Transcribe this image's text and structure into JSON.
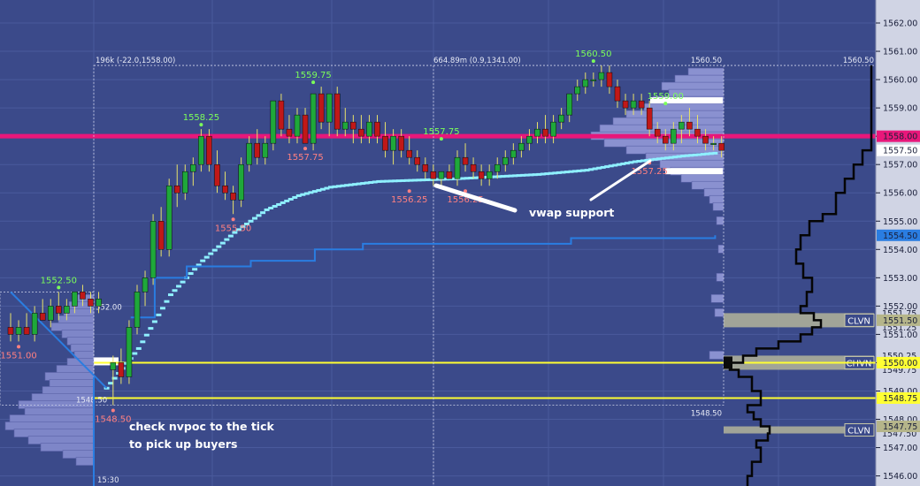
{
  "chart_data": {
    "type": "candlestick",
    "axis": {
      "ylim": [
        1545.8,
        1562.5
      ],
      "ticks": [
        1562.0,
        1561.0,
        1560.0,
        1559.0,
        1558.0,
        1557.0,
        1556.0,
        1555.0,
        1554.0,
        1553.0,
        1552.0,
        1551.0,
        1550.0,
        1549.0,
        1548.0,
        1547.0,
        1546.0
      ],
      "tick_labels": [
        "1562.00",
        "1561.00",
        "1560.00",
        "1559.00",
        "1558.00",
        "1557.00",
        "1556.00",
        "1555.00",
        "1554.00",
        "1553.00",
        "1552.00",
        "1551.00",
        "1550.00",
        "1549.00",
        "1548.00",
        "1547.00",
        "1546.00"
      ],
      "price_tags": [
        {
          "value": 1558.0,
          "text": "1558.00",
          "color": "#e8177a"
        },
        {
          "value": 1557.5,
          "text": "1557.50",
          "color": "#ffffff"
        },
        {
          "value": 1554.5,
          "text": "1554.50",
          "color": "#2a7de1"
        },
        {
          "value": 1551.5,
          "text": "1551.50",
          "color": "#b5b58a"
        },
        {
          "value": 1550.0,
          "text": "1550.00",
          "color": "#ffff33"
        },
        {
          "value": 1548.75,
          "text": "1548.75",
          "color": "#ffff33"
        },
        {
          "value": 1547.75,
          "text": "1547.75",
          "color": "#b5b58a"
        }
      ],
      "minor_texts": [
        {
          "value": 1551.75,
          "text": "1551.75"
        },
        {
          "value": 1551.25,
          "text": "1551.25"
        },
        {
          "value": 1550.25,
          "text": "1550.25"
        },
        {
          "value": 1549.75,
          "text": "1549.75"
        },
        {
          "value": 1547.5,
          "text": "1547.50"
        }
      ]
    },
    "candles": [
      [
        1551.25,
        1551.75,
        1550.75,
        1551.0
      ],
      [
        1551.0,
        1551.5,
        1550.75,
        1551.25
      ],
      [
        1551.25,
        1551.75,
        1551.0,
        1551.0
      ],
      [
        1551.0,
        1552.0,
        1550.75,
        1551.75
      ],
      [
        1551.75,
        1552.25,
        1551.5,
        1551.5
      ],
      [
        1551.5,
        1552.25,
        1551.25,
        1552.0
      ],
      [
        1552.0,
        1552.5,
        1551.5,
        1551.75
      ],
      [
        1551.75,
        1552.25,
        1551.5,
        1552.0
      ],
      [
        1552.0,
        1552.5,
        1551.75,
        1552.5
      ],
      [
        1552.5,
        1552.75,
        1552.0,
        1552.25
      ],
      [
        1552.25,
        1552.5,
        1551.75,
        1552.0
      ],
      [
        1552.0,
        1552.5,
        1551.75,
        1552.25
      ],
      [
        1549.75,
        1550.25,
        1548.5,
        1550.0
      ],
      [
        1550.0,
        1550.5,
        1549.25,
        1549.5
      ],
      [
        1549.5,
        1551.5,
        1549.25,
        1551.25
      ],
      [
        1551.25,
        1552.75,
        1551.0,
        1552.5
      ],
      [
        1552.5,
        1553.25,
        1552.0,
        1553.0
      ],
      [
        1553.0,
        1555.25,
        1552.75,
        1555.0
      ],
      [
        1555.0,
        1555.5,
        1553.75,
        1554.0
      ],
      [
        1554.0,
        1556.5,
        1553.75,
        1556.25
      ],
      [
        1556.25,
        1557.0,
        1555.5,
        1556.0
      ],
      [
        1556.0,
        1557.0,
        1555.75,
        1556.75
      ],
      [
        1556.75,
        1557.25,
        1556.25,
        1557.0
      ],
      [
        1557.0,
        1558.25,
        1556.75,
        1558.0
      ],
      [
        1558.0,
        1558.25,
        1556.75,
        1557.0
      ],
      [
        1557.0,
        1557.5,
        1556.0,
        1556.25
      ],
      [
        1556.25,
        1556.75,
        1555.75,
        1556.0
      ],
      [
        1556.0,
        1556.25,
        1555.25,
        1555.75
      ],
      [
        1555.75,
        1557.25,
        1555.5,
        1557.0
      ],
      [
        1557.0,
        1558.0,
        1556.75,
        1557.75
      ],
      [
        1557.75,
        1558.25,
        1557.0,
        1557.25
      ],
      [
        1557.25,
        1558.0,
        1557.0,
        1557.75
      ],
      [
        1557.75,
        1559.0,
        1557.5,
        1559.25
      ],
      [
        1559.25,
        1559.5,
        1558.0,
        1558.25
      ],
      [
        1558.25,
        1558.75,
        1557.75,
        1558.0
      ],
      [
        1558.0,
        1559.0,
        1557.75,
        1558.75
      ],
      [
        1558.75,
        1559.0,
        1557.75,
        1557.75
      ],
      [
        1557.75,
        1559.5,
        1557.5,
        1559.5
      ],
      [
        1559.5,
        1559.75,
        1558.25,
        1558.5
      ],
      [
        1558.5,
        1559.5,
        1558.0,
        1559.5
      ],
      [
        1559.5,
        1559.75,
        1558.0,
        1558.25
      ],
      [
        1558.25,
        1559.0,
        1558.0,
        1558.5
      ],
      [
        1558.5,
        1558.75,
        1557.75,
        1558.25
      ],
      [
        1558.25,
        1558.75,
        1557.75,
        1558.0
      ],
      [
        1558.0,
        1558.75,
        1557.75,
        1558.5
      ],
      [
        1558.5,
        1558.75,
        1557.75,
        1558.0
      ],
      [
        1558.0,
        1558.5,
        1557.25,
        1557.5
      ],
      [
        1557.5,
        1558.25,
        1557.0,
        1558.0
      ],
      [
        1558.0,
        1558.25,
        1557.25,
        1557.5
      ],
      [
        1557.5,
        1558.0,
        1557.0,
        1557.25
      ],
      [
        1557.25,
        1557.5,
        1556.75,
        1557.0
      ],
      [
        1557.0,
        1557.25,
        1556.5,
        1556.75
      ],
      [
        1556.75,
        1557.0,
        1556.25,
        1556.5
      ],
      [
        1556.5,
        1556.75,
        1556.25,
        1556.75
      ],
      [
        1556.75,
        1557.0,
        1556.5,
        1556.5
      ],
      [
        1556.5,
        1557.5,
        1556.25,
        1557.25
      ],
      [
        1557.25,
        1557.75,
        1556.75,
        1557.0
      ],
      [
        1557.0,
        1557.25,
        1556.5,
        1556.75
      ],
      [
        1556.75,
        1557.0,
        1556.25,
        1556.5
      ],
      [
        1556.5,
        1557.0,
        1556.25,
        1556.75
      ],
      [
        1556.75,
        1557.25,
        1556.5,
        1557.0
      ],
      [
        1557.0,
        1557.5,
        1556.75,
        1557.25
      ],
      [
        1557.25,
        1557.75,
        1557.0,
        1557.5
      ],
      [
        1557.5,
        1558.0,
        1557.25,
        1557.75
      ],
      [
        1557.75,
        1558.25,
        1557.5,
        1558.0
      ],
      [
        1558.0,
        1558.5,
        1557.75,
        1558.25
      ],
      [
        1558.25,
        1558.75,
        1557.75,
        1558.0
      ],
      [
        1558.0,
        1558.75,
        1557.75,
        1558.5
      ],
      [
        1558.5,
        1559.0,
        1558.25,
        1558.75
      ],
      [
        1558.75,
        1559.5,
        1558.5,
        1559.5
      ],
      [
        1559.5,
        1560.0,
        1559.25,
        1559.75
      ],
      [
        1559.75,
        1560.25,
        1559.5,
        1560.0
      ],
      [
        1560.0,
        1560.25,
        1559.75,
        1560.0
      ],
      [
        1560.0,
        1560.5,
        1559.75,
        1560.25
      ],
      [
        1560.25,
        1560.5,
        1559.5,
        1559.75
      ],
      [
        1559.75,
        1560.0,
        1559.0,
        1559.25
      ],
      [
        1559.25,
        1559.5,
        1558.75,
        1559.0
      ],
      [
        1559.0,
        1559.5,
        1558.75,
        1559.25
      ],
      [
        1559.25,
        1559.5,
        1558.75,
        1559.0
      ],
      [
        1559.0,
        1559.25,
        1558.0,
        1558.25
      ],
      [
        1558.25,
        1558.5,
        1557.75,
        1558.0
      ],
      [
        1558.0,
        1558.25,
        1557.5,
        1557.75
      ],
      [
        1557.75,
        1558.5,
        1557.5,
        1558.25
      ],
      [
        1558.25,
        1558.75,
        1557.75,
        1558.5
      ],
      [
        1558.5,
        1559.0,
        1558.0,
        1558.25
      ],
      [
        1558.25,
        1558.75,
        1557.75,
        1558.0
      ],
      [
        1558.0,
        1558.25,
        1557.5,
        1557.75
      ],
      [
        1557.75,
        1558.0,
        1557.5,
        1557.75
      ],
      [
        1557.75,
        1558.0,
        1557.25,
        1557.5
      ]
    ],
    "vwap": [
      [
        0,
        1552.5
      ],
      [
        12,
        1549.1
      ],
      [
        16,
        1550.5
      ],
      [
        20,
        1552.4
      ],
      [
        24,
        1553.6
      ],
      [
        28,
        1554.6
      ],
      [
        32,
        1555.4
      ],
      [
        36,
        1555.9
      ],
      [
        40,
        1556.2
      ],
      [
        46,
        1556.4
      ],
      [
        56,
        1556.5
      ],
      [
        66,
        1556.65
      ],
      [
        72,
        1556.8
      ],
      [
        78,
        1557.1
      ],
      [
        84,
        1557.3
      ],
      [
        88,
        1557.4
      ]
    ],
    "dev_poc": [
      [
        15,
        1551.6
      ],
      [
        18,
        1553.0
      ],
      [
        22,
        1553.4
      ],
      [
        30,
        1553.6
      ],
      [
        38,
        1554.0
      ],
      [
        44,
        1554.2
      ],
      [
        60,
        1554.2
      ],
      [
        66,
        1554.2
      ],
      [
        70,
        1554.4
      ],
      [
        88,
        1554.5
      ]
    ],
    "swing_labels": [
      {
        "i": 6,
        "price": 1552.5,
        "text": "1552.50",
        "pos": "top"
      },
      {
        "i": 1,
        "price": 1550.75,
        "text": "1551.00",
        "pos": "bottom"
      },
      {
        "i": 12,
        "price": 1548.5,
        "text": "1548.50",
        "pos": "bottom"
      },
      {
        "i": 23,
        "price": 1558.25,
        "text": "1558.25",
        "pos": "top"
      },
      {
        "i": 27,
        "price": 1555.25,
        "text": "1555.50",
        "pos": "bottom"
      },
      {
        "i": 37,
        "price": 1559.75,
        "text": "1559.75",
        "pos": "top"
      },
      {
        "i": 36,
        "price": 1557.75,
        "text": "1557.75",
        "pos": "bottom"
      },
      {
        "i": 49,
        "price": 1556.25,
        "text": "1556.25",
        "pos": "bottom"
      },
      {
        "i": 53,
        "price": 1557.75,
        "text": "1557.75",
        "pos": "top"
      },
      {
        "i": 56,
        "price": 1556.25,
        "text": "1556.25",
        "pos": "bottom"
      },
      {
        "i": 72,
        "price": 1560.5,
        "text": "1560.50",
        "pos": "top"
      },
      {
        "i": 81,
        "price": 1559.0,
        "text": "1559.00",
        "pos": "top"
      },
      {
        "i": 79,
        "price": 1557.25,
        "text": "1557.25",
        "pos": "bottom"
      }
    ],
    "levels": [
      {
        "price": 1558.0,
        "color": "#e8177a",
        "width": 5
      },
      {
        "price": 1550.0,
        "color": "#ffff33",
        "width": 2
      },
      {
        "price": 1548.75,
        "color": "#ffff33",
        "width": 2
      }
    ],
    "zones": [
      {
        "from": 1551.25,
        "to": 1551.75,
        "label": "CLVN"
      },
      {
        "from": 1549.75,
        "to": 1550.25,
        "label": "CHVN"
      },
      {
        "from": 1547.5,
        "to": 1547.75,
        "label": "CLVN"
      }
    ],
    "box_labels": {
      "left_top": "196k (-22.0,1558.00)",
      "mid_top": "664.89m (0.9,1341.00)",
      "top_price": "1560.50",
      "top_price_right": "1560.50",
      "bottom_price": "1548.50",
      "left_box_top": "1548.50",
      "left_box_mid": "552.00",
      "time": "15:30"
    },
    "annotations": {
      "vwap": "vwap support",
      "nvpoc_line1": "check nvpoc to the tick",
      "nvpoc_line2": "to pick up buyers"
    }
  }
}
